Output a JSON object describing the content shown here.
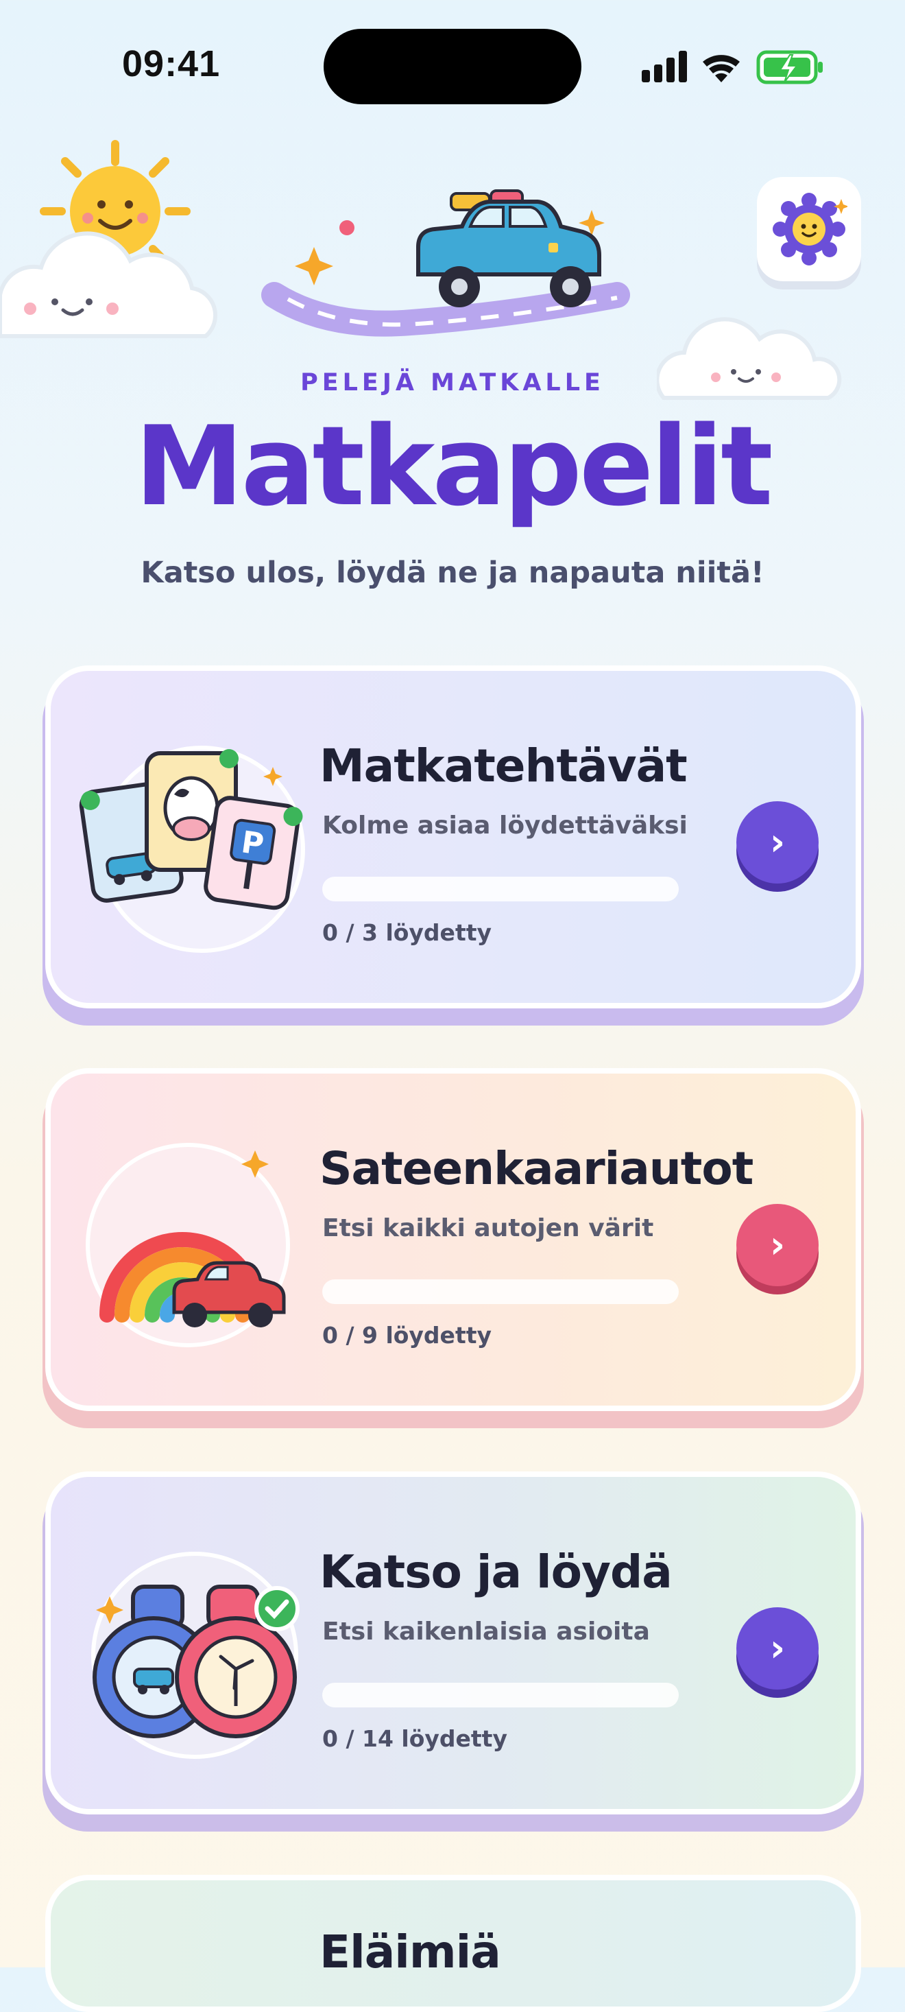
{
  "status_bar": {
    "time": "09:41"
  },
  "header": {
    "eyebrow": "PELEJÄ MATKALLE",
    "title": "Matkapelit",
    "subtitle": "Katso ulos, löydä ne ja napauta niitä!"
  },
  "settings": {
    "icon": "gear-smiley-icon"
  },
  "cards": [
    {
      "title": "Matkatehtävät",
      "description": "Kolme asiaa löydettäväksi",
      "count": "0 / 3 löydetty",
      "progress": 0,
      "accent": "#6b4fd8"
    },
    {
      "title": "Sateenkaariautot",
      "description": "Etsi kaikki autojen värit",
      "count": "0 / 9 löydetty",
      "progress": 0,
      "accent": "#e8587a"
    },
    {
      "title": "Katso ja löydä",
      "description": "Etsi kaikenlaisia asioita",
      "count": "0 / 14 löydetty",
      "progress": 0,
      "accent": "#6b4fd8"
    },
    {
      "title": "Eläimiä"
    }
  ]
}
